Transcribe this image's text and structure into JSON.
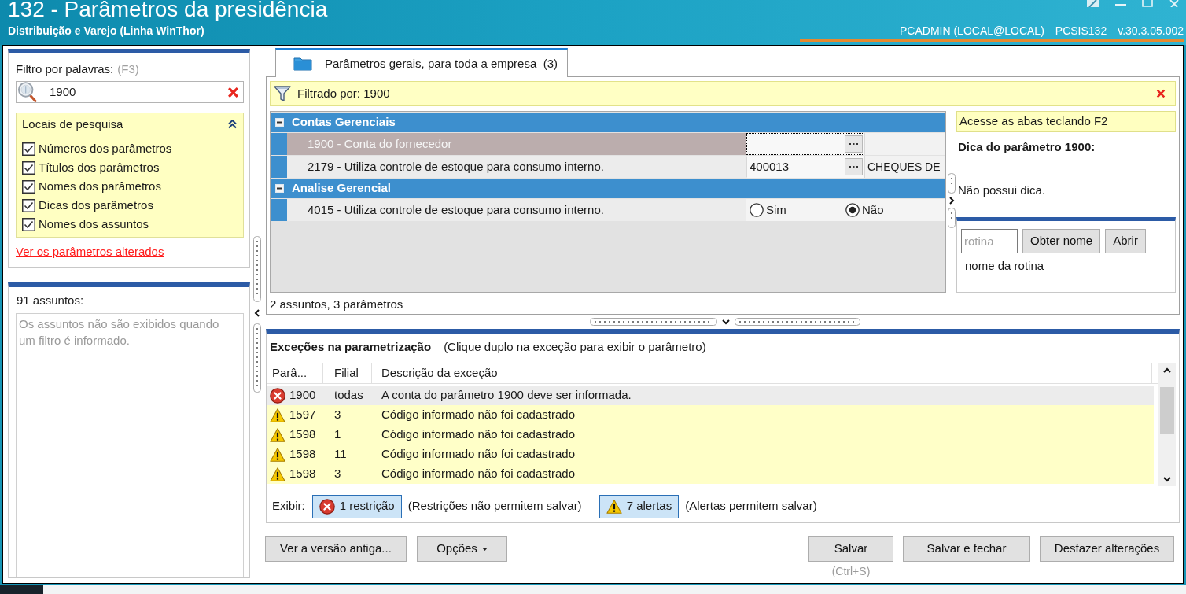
{
  "window": {
    "title": "132 - Parâmetros da presidência",
    "subtitle": "Distribuição e Varejo (Linha WinThor)",
    "user": "PCADMIN (LOCAL@LOCAL)",
    "routine": "PCSIS132",
    "version": "v.30.3.05.002"
  },
  "filter_panel": {
    "label": "Filtro por palavras:",
    "shortcut": "(F3)",
    "search": {
      "value": "1900"
    },
    "search_locations": {
      "title": "Locais de pesquisa",
      "expanded": true,
      "options": [
        {
          "label": "Números dos parâmetros",
          "checked": true
        },
        {
          "label": "Títulos dos parâmetros",
          "checked": true
        },
        {
          "label": "Nomes dos parâmetros",
          "checked": true
        },
        {
          "label": "Dicas dos parâmetros",
          "checked": true
        },
        {
          "label": "Nomes dos assuntos",
          "checked": true
        }
      ]
    },
    "changed_link": "Ver os parâmetros alterados"
  },
  "subjects_panel": {
    "count_label": "91 assuntos:",
    "empty_text": "Os assuntos não são exibidos quando um filtro é informado."
  },
  "tabs": [
    {
      "label": "Parâmetros gerais, para toda a empresa  (3)",
      "selected": true
    }
  ],
  "filter_bar": {
    "label": "Filtrado por: 1900"
  },
  "parameter_groups": [
    {
      "name": "Contas Gerenciais",
      "expanded": true,
      "parameters": [
        {
          "kind": "lookup",
          "label": "1900 - Conta do fornecedor",
          "selected": true
        },
        {
          "kind": "lookup",
          "label": "2179 - Utiliza controle de estoque para consumo interno.",
          "selected": false,
          "value": "400013",
          "description": "CHEQUES DE"
        }
      ]
    },
    {
      "name": "Analise Gerencial",
      "expanded": true,
      "parameters": [
        {
          "kind": "choice",
          "label": "4015 - Utiliza controle de estoque para consumo interno.",
          "selected": false,
          "options": [
            {
              "label": "Sim",
              "selected": false
            },
            {
              "label": "Não",
              "selected": true
            }
          ]
        }
      ]
    }
  ],
  "grid_summary": "2 assuntos, 3 parâmetros",
  "hint_panel": {
    "shortcut_tip": "Acesse as abas teclando F2",
    "title": "Dica do parâmetro 1900:",
    "text": "Não possui dica."
  },
  "routine_lookup": {
    "input": {
      "placeholder": "rotina"
    },
    "buttons": [
      "Obter nome",
      "Abrir"
    ],
    "result": "nome da rotina"
  },
  "exceptions": {
    "title": "Exceções na parametrização",
    "instruction": "(Clique duplo na exceção para exibir o parâmetro)",
    "columns": [
      "Parâ...",
      "Filial",
      "Descrição da exceção"
    ],
    "rows": [
      {
        "kind": "error",
        "parameter": "1900",
        "branch": "todas",
        "description": "A conta do parâmetro 1900 deve ser informada.",
        "selected": true
      },
      {
        "kind": "warning",
        "parameter": "1597",
        "branch": "3",
        "description": "Código informado não foi cadastrado",
        "selected": false
      },
      {
        "kind": "warning",
        "parameter": "1598",
        "branch": "1",
        "description": "Código informado não foi cadastrado",
        "selected": false
      },
      {
        "kind": "warning",
        "parameter": "1598",
        "branch": "11",
        "description": "Código informado não foi cadastrado",
        "selected": false
      },
      {
        "kind": "warning",
        "parameter": "1598",
        "branch": "3",
        "description": "Código informado não foi cadastrado",
        "selected": false
      }
    ]
  },
  "display_filters": {
    "label": "Exibir:",
    "toggles": [
      {
        "kind": "error",
        "label": "1 restrição",
        "note": "(Restrições não permitem salvar)",
        "on": true
      },
      {
        "kind": "warning",
        "label": "7 alertas",
        "note": "(Alertas permitem salvar)",
        "on": true
      }
    ]
  },
  "footer": {
    "left_buttons": [
      {
        "kind": "plain",
        "label": "Ver a versão antiga..."
      },
      {
        "kind": "dropdown",
        "label": "Opções"
      }
    ],
    "right_buttons": [
      {
        "label": "Salvar",
        "shortcut": "(Ctrl+S)"
      },
      {
        "label": "Salvar e fechar"
      },
      {
        "label": "Desfazer alterações"
      }
    ]
  }
}
